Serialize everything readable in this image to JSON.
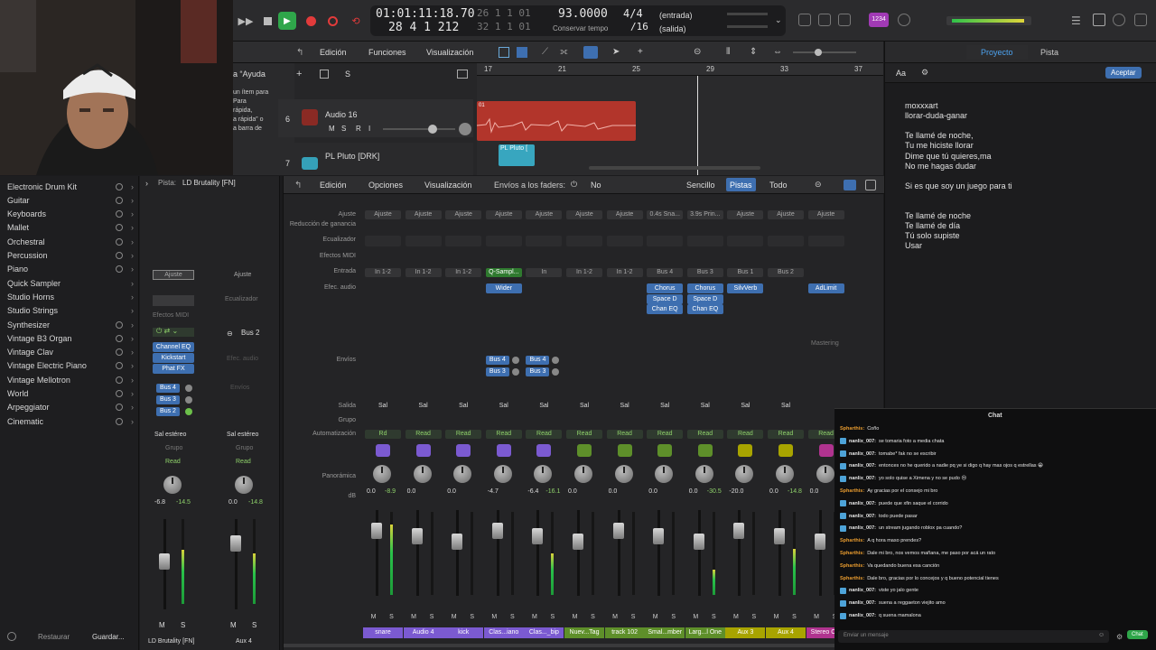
{
  "transport": {
    "position_bars": "01:01:11:18.70",
    "position_beats": "28  4  1  212",
    "lcd_right_top": "26  1  1    01",
    "lcd_right_bottom": "32  1  1    01",
    "tempo": "93.0000",
    "tempo_label": "Conservar tempo",
    "signature": "4/4",
    "division": "/16",
    "input": "(entrada)",
    "output": "(salida)",
    "badge": "1234"
  },
  "tracks": {
    "menu": [
      "Edición",
      "Funciones",
      "Visualización"
    ],
    "ruler": [
      "17",
      "21",
      "25",
      "29",
      "33",
      "37"
    ],
    "help_title": "a “Ayuda",
    "help_text": "un ítem para\nPara\nrápida,\na rápida” o\na barra de",
    "track_numbers": [
      "6",
      "7"
    ],
    "track_names": [
      "Audio 16",
      "PL Pluto [DRK]"
    ],
    "region_labels": [
      "PL Pluto ["
    ],
    "region_marker": "01"
  },
  "library": {
    "items": [
      {
        "label": "Electronic Drum Kit",
        "plus": true
      },
      {
        "label": "Guitar",
        "plus": true
      },
      {
        "label": "Keyboards",
        "plus": true
      },
      {
        "label": "Mallet",
        "plus": true
      },
      {
        "label": "Orchestral",
        "plus": true
      },
      {
        "label": "Percussion",
        "plus": true
      },
      {
        "label": "Piano",
        "plus": true
      },
      {
        "label": "Quick Sampler",
        "plus": false
      },
      {
        "label": "Studio Horns",
        "plus": false
      },
      {
        "label": "Studio Strings",
        "plus": false
      },
      {
        "label": "Synthesizer",
        "plus": true
      },
      {
        "label": "Vintage B3 Organ",
        "plus": true
      },
      {
        "label": "Vintage Clav",
        "plus": true
      },
      {
        "label": "Vintage Electric Piano",
        "plus": true
      },
      {
        "label": "Vintage Mellotron",
        "plus": true
      },
      {
        "label": "World",
        "plus": true
      },
      {
        "label": "Arpeggiator",
        "plus": true
      },
      {
        "label": "Cinematic",
        "plus": true
      }
    ],
    "restore_label": "Restaurar",
    "save_label": "Guardar..."
  },
  "inspector": {
    "track_label": "Pista:",
    "track_name": "LD Brutality [FN]",
    "ajuste": "Ajuste",
    "eq": "Ecualizador",
    "midi": "Efectos MIDI",
    "bus2": "Bus 2",
    "plugins": [
      "Channel EQ",
      "Kickstart",
      "Phat FX"
    ],
    "sends": [
      "Bus 4",
      "Bus 3",
      "Bus 2"
    ],
    "out1": "Sal estéreo",
    "out2": "Sal estéreo",
    "group": "Grupo",
    "read": "Read",
    "db1_a": "-6.8",
    "db1_b": "-14.5",
    "db2_a": "0.0",
    "db2_b": "-14.8",
    "name1": "LD Brutality [FN]",
    "name2": "Aux 4",
    "m": "M",
    "s": "S",
    "envios": "Envíos",
    "efec_audio": "Efec. audio"
  },
  "mixer": {
    "menu": [
      "Edición",
      "Opciones",
      "Visualización"
    ],
    "sends_on_faders": "Envíos a los faders:",
    "sends_value": "No",
    "view_buttons": [
      "Sencillo",
      "Pistas",
      "Todo"
    ],
    "row_labels": {
      "ajuste": "Ajuste",
      "gain": "Reducción de ganancia",
      "eq": "Ecualizador",
      "midi": "Efectos MIDI",
      "input": "Entrada",
      "audio_fx": "Efec. audio",
      "sends": "Envíos",
      "output": "Salida",
      "group": "Grupo",
      "automation": "Automatización",
      "pan": "Panorámica",
      "db": "dB"
    },
    "mastering": "Mastering",
    "strips": [
      {
        "ajuste": "Ajuste",
        "input": "In 1-2",
        "plugins": [],
        "sends": [],
        "out": "Sal",
        "auto": "Rd",
        "db_a": "0.0",
        "db_b": "-8.9",
        "name": "snare",
        "color": "#7b5ad1",
        "level": 0.85
      },
      {
        "ajuste": "Ajuste",
        "input": "In 1-2",
        "plugins": [],
        "sends": [],
        "out": "Sal",
        "auto": "Read",
        "db_a": "0.0",
        "db_b": "",
        "name": "Audio 4",
        "color": "#7b5ad1",
        "level": 0
      },
      {
        "ajuste": "Ajuste",
        "input": "In 1-2",
        "plugins": [],
        "sends": [],
        "out": "Sal",
        "auto": "Read",
        "db_a": "0.0",
        "db_b": "",
        "name": "kick",
        "color": "#7b5ad1",
        "level": 0
      },
      {
        "ajuste": "Ajuste",
        "input": "Q-Sampl...",
        "plugins": [
          "Wider"
        ],
        "sends": [
          "Bus 4",
          "Bus 3"
        ],
        "out": "Sal",
        "auto": "Read",
        "db_a": "-4.7",
        "db_b": "",
        "name": "Clas...iano",
        "color": "#7b5ad1",
        "level": 0
      },
      {
        "ajuste": "Ajuste",
        "input": "In",
        "plugins": [],
        "sends": [
          "Bus 4",
          "Bus 3"
        ],
        "out": "Sal",
        "auto": "Read",
        "db_a": "-6.4",
        "db_b": "-16.1",
        "name": "Clas..._bip",
        "color": "#7b5ad1",
        "level": 0.5
      },
      {
        "ajuste": "Ajuste",
        "input": "In 1-2",
        "plugins": [],
        "sends": [],
        "out": "Sal",
        "auto": "Read",
        "db_a": "0.0",
        "db_b": "",
        "name": "Nuev...Tag",
        "color": "#5e8f2a",
        "level": 0
      },
      {
        "ajuste": "Ajuste",
        "input": "In 1-2",
        "plugins": [],
        "sends": [],
        "out": "Sal",
        "auto": "Read",
        "db_a": "0.0",
        "db_b": "",
        "name": "track 102",
        "color": "#5e8f2a",
        "level": 0
      },
      {
        "ajuste": "0.4s Sna...",
        "input": "Bus 4",
        "plugins": [
          "Chorus",
          "Space D",
          "Chan EQ"
        ],
        "sends": [],
        "out": "Sal",
        "auto": "Read",
        "db_a": "0.0",
        "db_b": "",
        "name": "Smal...mber",
        "color": "#5e8f2a",
        "level": 0
      },
      {
        "ajuste": "3.9s Prin...",
        "input": "Bus 3",
        "plugins": [
          "Chorus",
          "Space D",
          "Chan EQ"
        ],
        "sends": [],
        "out": "Sal",
        "auto": "Read",
        "db_a": "0.0",
        "db_b": "-30.5",
        "name": "Larg...l One",
        "color": "#5e8f2a",
        "level": 0.3
      },
      {
        "ajuste": "Ajuste",
        "input": "Bus 1",
        "plugins": [
          "SilvVerb"
        ],
        "sends": [],
        "out": "Sal",
        "auto": "Read",
        "db_a": "-20.0",
        "db_b": "",
        "name": "Aux 3",
        "color": "#a8a400",
        "level": 0
      },
      {
        "ajuste": "Ajuste",
        "input": "Bus 2",
        "plugins": [],
        "sends": [],
        "out": "Sal",
        "auto": "Read",
        "db_a": "0.0",
        "db_b": "-14.8",
        "name": "Aux 4",
        "color": "#a8a400",
        "level": 0.55
      },
      {
        "ajuste": "Ajuste",
        "input": "",
        "plugins": [
          "AdLimit"
        ],
        "sends": [],
        "out": "",
        "auto": "Read",
        "db_a": "0.0",
        "db_b": "",
        "name": "Stereo Out",
        "color": "#b0338f",
        "level": 0
      }
    ]
  },
  "lyrics": {
    "tab_project": "Proyecto",
    "tab_track": "Pista",
    "aa": "Aa",
    "accept": "Aceptar",
    "lines": [
      "moxxxart",
      "llorar-duda-ganar",
      "",
      "Te llamé de noche,",
      "Tu me hiciste llorar",
      "Dime que tú quieres,ma",
      "No me hagas dudar",
      "",
      "Si es que soy un juego para ti",
      "",
      "",
      "Te llamé de noche",
      "Te llamé de día",
      "Tú solo supiste",
      "Usar"
    ]
  },
  "chat": {
    "title": "Chat",
    "placeholder": "Enviar un mensaje",
    "send": "Chat",
    "messages": [
      {
        "user": "Spharthis:",
        "text": "Coño",
        "icon": false,
        "color": "#e69a2e"
      },
      {
        "user": "nanlix_007:",
        "text": "se tomaria foto a media chata",
        "icon": true,
        "color": "#e6e6e6"
      },
      {
        "user": "nanlix_007:",
        "text": "tomabe* fak no se escribir",
        "icon": true,
        "color": "#e6e6e6"
      },
      {
        "user": "nanlix_007:",
        "text": "entonces no he querido a nadie pq ye si digo q hay mas ojos q estrellas 😁",
        "icon": true,
        "color": "#e6e6e6"
      },
      {
        "user": "nanlix_007:",
        "text": "yo solo quise a Ximena y no se pudo 😢",
        "icon": true,
        "color": "#e6e6e6"
      },
      {
        "user": "Spharthis:",
        "text": "Ay gracias por el consejo mi bro",
        "icon": false,
        "color": "#e69a2e"
      },
      {
        "user": "nanlix_007:",
        "text": "puede que xfin saque el corrido",
        "icon": true,
        "color": "#e6e6e6"
      },
      {
        "user": "nanlix_007:",
        "text": "todo puede pasar",
        "icon": true,
        "color": "#e6e6e6"
      },
      {
        "user": "nanlix_007:",
        "text": "un stream jugando roblox pa cuando?",
        "icon": true,
        "color": "#e6e6e6"
      },
      {
        "user": "Spharthis:",
        "text": "A q hora maso prendes?",
        "icon": false,
        "color": "#e69a2e"
      },
      {
        "user": "Spharthis:",
        "text": "Dale mi bro, nos vemos mañana, me paso por acá un rato",
        "icon": false,
        "color": "#e69a2e"
      },
      {
        "user": "Spharthis:",
        "text": "Va quedando buena esa canción",
        "icon": false,
        "color": "#e69a2e"
      },
      {
        "user": "Spharthis:",
        "text": "Dale bro, gracias por lo concejos y q bueno potencial tienes",
        "icon": false,
        "color": "#e69a2e"
      },
      {
        "user": "nanlix_007:",
        "text": "viste yo jalo gente",
        "icon": true,
        "color": "#e6e6e6"
      },
      {
        "user": "nanlix_007:",
        "text": "suena a reggaeton viejito amo",
        "icon": true,
        "color": "#e6e6e6"
      },
      {
        "user": "nanlix_007:",
        "text": "q suena mamalona",
        "icon": true,
        "color": "#e6e6e6"
      }
    ]
  }
}
